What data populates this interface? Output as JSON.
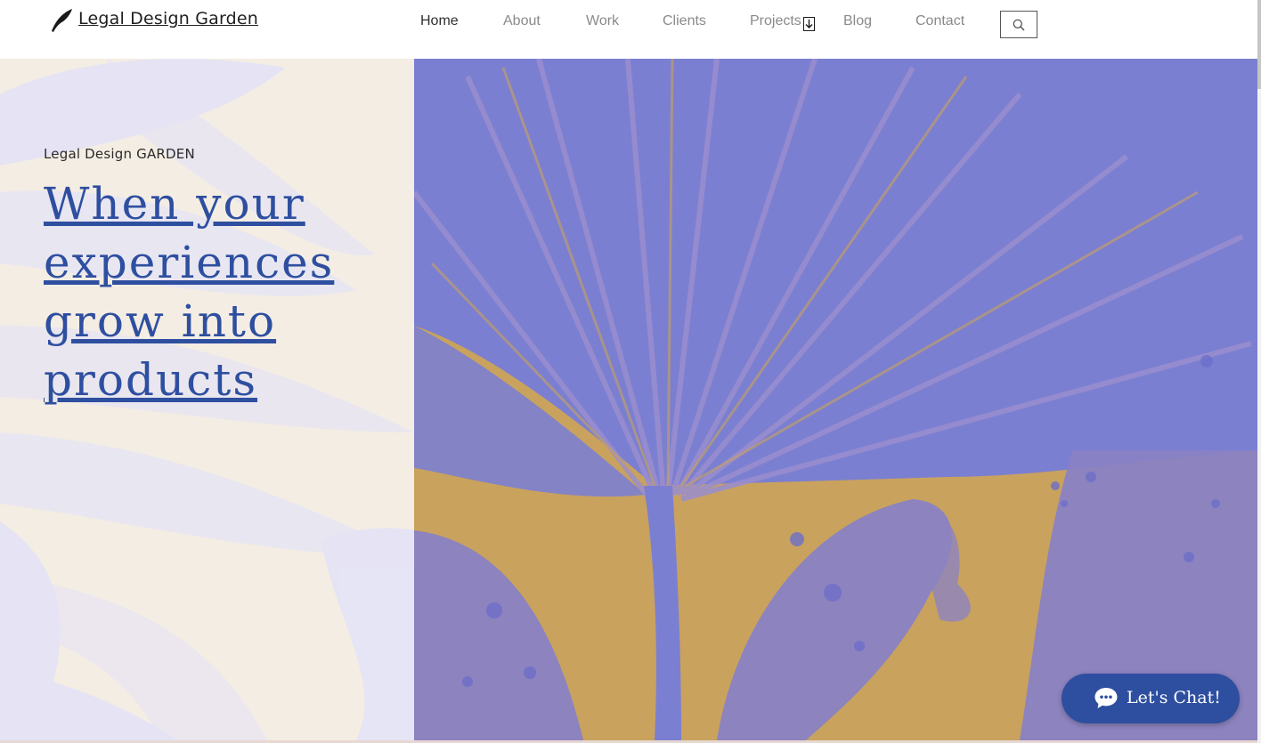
{
  "header": {
    "brand": "Legal Design Garden",
    "nav": [
      {
        "label": "Home"
      },
      {
        "label": "About"
      },
      {
        "label": "Work"
      },
      {
        "label": "Clients"
      },
      {
        "label": "Projects"
      },
      {
        "label": "Blog"
      },
      {
        "label": "Contact"
      }
    ],
    "active": "Home",
    "icons": {
      "logo": "feather-icon",
      "search": "search-icon",
      "dropdown": "chevron-down-icon"
    }
  },
  "hero": {
    "eyebrow": "Legal Design GARDEN",
    "headline": "When your experiences grow into products"
  },
  "chat": {
    "label": "Let's Chat!",
    "icon": "chat-bubble-icon"
  },
  "colors": {
    "accent": "#2e4fa0",
    "left_panel_bg": "#f4ede3",
    "artwork_purple": "#7b7fd1",
    "artwork_gold": "#c9a25e"
  }
}
